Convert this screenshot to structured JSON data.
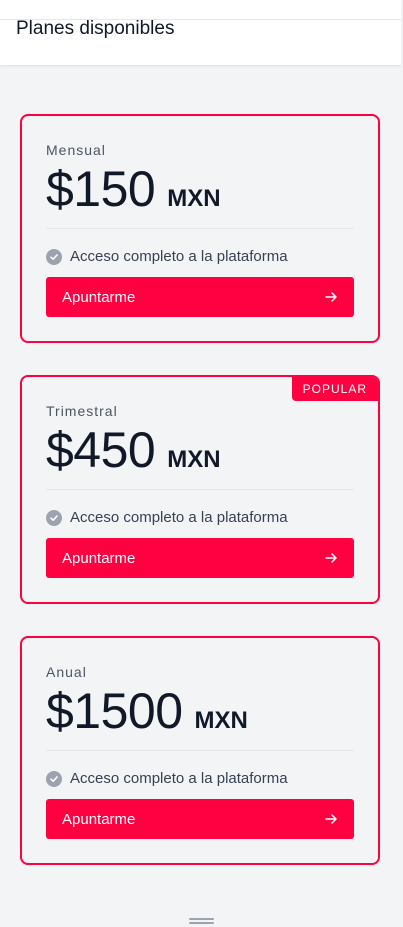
{
  "header": {
    "title": "Planes disponibles"
  },
  "plans": [
    {
      "name": "Mensual",
      "amount": "$150",
      "currency": "MXN",
      "feature": "Acceso completo a la plataforma",
      "cta": "Apuntarme",
      "badge": ""
    },
    {
      "name": "Trimestral",
      "amount": "$450",
      "currency": "MXN",
      "feature": "Acceso completo a la plataforma",
      "cta": "Apuntarme",
      "badge": "POPULAR"
    },
    {
      "name": "Anual",
      "amount": "$1500",
      "currency": "MXN",
      "feature": "Acceso completo a la plataforma",
      "cta": "Apuntarme",
      "badge": ""
    }
  ],
  "colors": {
    "accent": "#ff0040",
    "background": "#f3f4f6",
    "text": "#111827"
  },
  "icons": {
    "feature": "check-circle-icon",
    "cta": "arrow-right-icon",
    "bottom": "drag-handle-icon"
  }
}
